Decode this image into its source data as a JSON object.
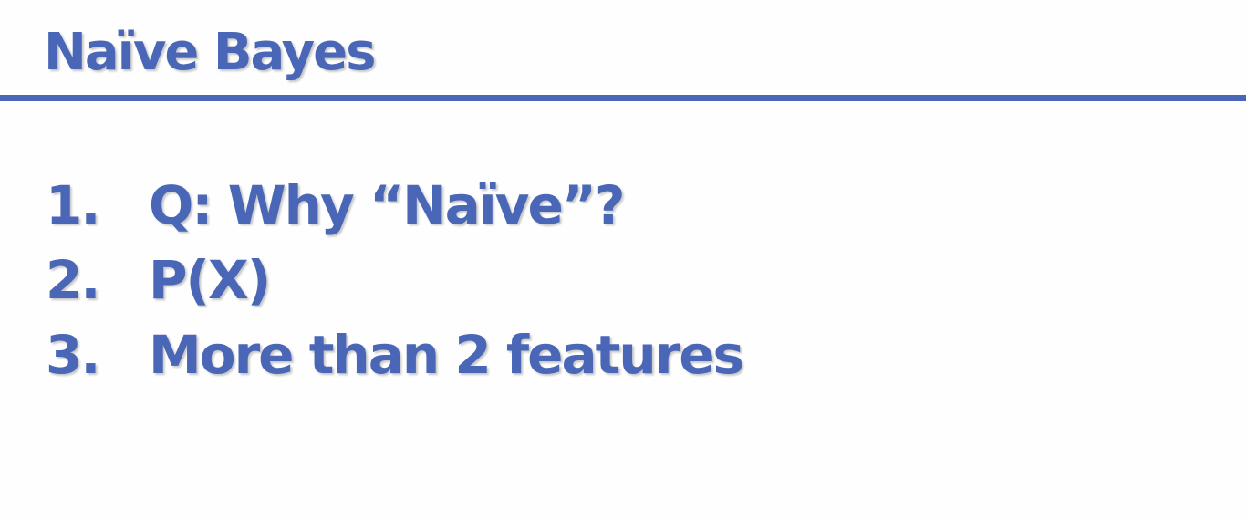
{
  "slide": {
    "title": "Naïve Bayes",
    "accent_color": "#4a66b6",
    "items": [
      {
        "number": "1.",
        "text": "Q: Why “Naïve”?"
      },
      {
        "number": "2.",
        "text": "P(X)"
      },
      {
        "number": "3.",
        "text": "More than 2 features"
      }
    ]
  }
}
